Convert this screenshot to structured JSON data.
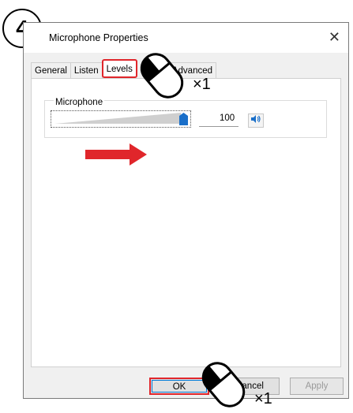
{
  "step_number": "4",
  "window": {
    "title": "Microphone Properties",
    "close_glyph": "✕"
  },
  "tabs": [
    {
      "label": "General"
    },
    {
      "label": "Listen"
    },
    {
      "label": "Levels"
    },
    {
      "label": "Advanced"
    }
  ],
  "levels": {
    "group_label": "Microphone",
    "value": "100",
    "slider_fraction": 1.0,
    "speaker_icon": "speaker-icon"
  },
  "buttons": {
    "ok": "OK",
    "cancel": "Cancel",
    "apply": "Apply"
  },
  "annotations": {
    "click_count_tab": "×1",
    "click_count_ok": "×1",
    "highlight_color": "#e0262b",
    "arrow_color": "#e0262b"
  }
}
